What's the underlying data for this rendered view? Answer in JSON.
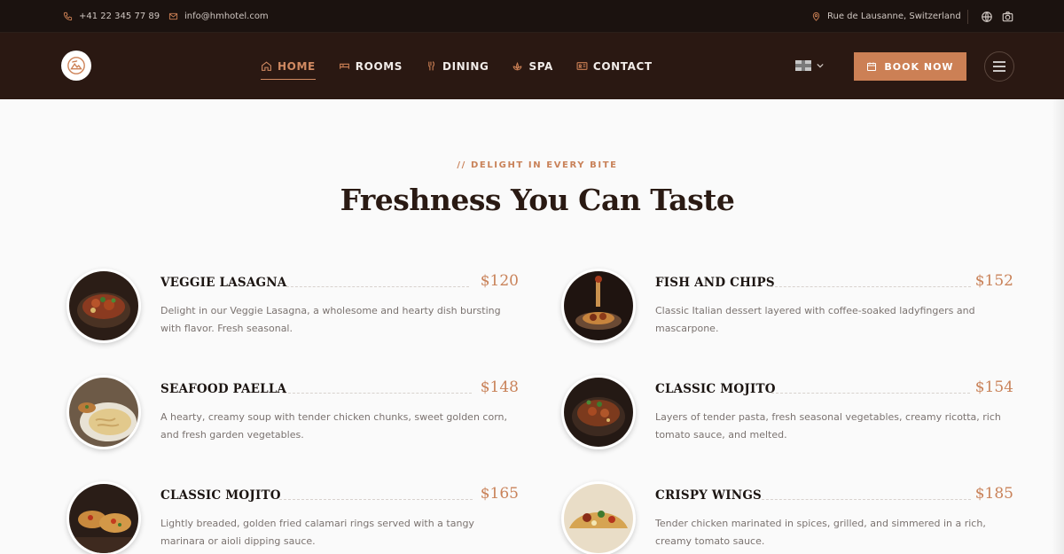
{
  "topbar": {
    "phone": "+41 22 345 77 89",
    "email": "info@hmhotel.com",
    "address": "Rue de Lausanne, Switzerland"
  },
  "nav": {
    "items": [
      {
        "label": "HOME",
        "icon": "home-icon",
        "active": true
      },
      {
        "label": "ROOMS",
        "icon": "bed-icon"
      },
      {
        "label": "DINING",
        "icon": "utensils-icon"
      },
      {
        "label": "SPA",
        "icon": "lotus-icon"
      },
      {
        "label": "CONTACT",
        "icon": "contact-card-icon"
      }
    ],
    "book_label": "BOOK NOW",
    "language": "uk-flag"
  },
  "section": {
    "eyebrow": "// DELIGHT IN EVERY BITE",
    "title": "Freshness You Can Taste"
  },
  "menu": [
    {
      "name": "VEGGIE LASAGNA",
      "price": "$120",
      "desc": "Delight in our Veggie Lasagna, a wholesome and hearty dish bursting with flavor. Fresh seasonal."
    },
    {
      "name": "FISH AND CHIPS",
      "price": "$152",
      "desc": "Classic Italian dessert layered with coffee-soaked ladyfingers and mascarpone."
    },
    {
      "name": "SEAFOOD PAELLA",
      "price": "$148",
      "desc": "A hearty, creamy soup with tender chicken chunks, sweet golden corn, and fresh garden vegetables."
    },
    {
      "name": "CLASSIC MOJITO",
      "price": "$154",
      "desc": "Layers of tender pasta, fresh seasonal vegetables, creamy ricotta, rich tomato sauce, and melted."
    },
    {
      "name": "CLASSIC MOJITO",
      "price": "$165",
      "desc": "Lightly breaded, golden fried calamari rings served with a tangy marinara or aioli dipping sauce."
    },
    {
      "name": "CRISPY WINGS",
      "price": "$185",
      "desc": "Tender chicken marinated in spices, grilled, and simmered in a rich, creamy tomato sauce."
    }
  ],
  "colors": {
    "accent": "#cc8055",
    "header_bg": "#2a1812",
    "topbar_bg": "#1b120f"
  }
}
